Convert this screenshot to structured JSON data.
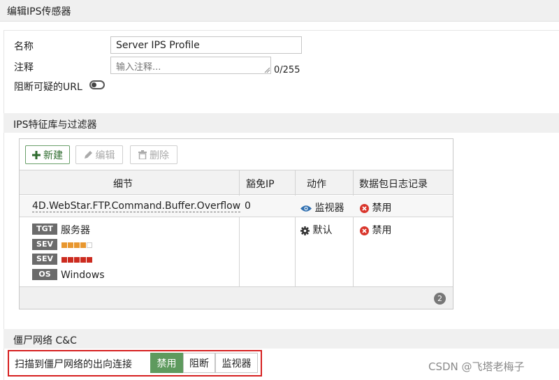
{
  "dialog": {
    "title": "编辑IPS传感器"
  },
  "form": {
    "name_label": "名称",
    "name_value": "Server IPS Profile",
    "comment_label": "注释",
    "comment_placeholder": "输入注释...",
    "comment_counter": "0/255",
    "block_url_label": "阻断可疑的URL",
    "block_url_enabled": false
  },
  "ips_section": {
    "title": "IPS特征库与过滤器",
    "toolbar": {
      "new_label": "新建",
      "edit_label": "编辑",
      "delete_label": "删除"
    },
    "columns": [
      "细节",
      "豁免IP",
      "动作",
      "数据包日志记录"
    ],
    "rows": [
      {
        "detail": "4D.WebStar.FTP.Command.Buffer.Overflow",
        "exempt_ip": "0",
        "action": "监视器",
        "action_icon": "eye-icon",
        "log": "禁用",
        "log_icon": "disabled-x-icon"
      },
      {
        "filters": [
          {
            "tag": "TGT",
            "value": "服务器"
          },
          {
            "tag": "SEV",
            "level": 4,
            "color": "#e8972f"
          },
          {
            "tag": "SEV",
            "level": 5,
            "color": "#cc2b1f"
          },
          {
            "tag": "OS",
            "value": "Windows"
          }
        ],
        "action": "默认",
        "action_icon": "gear-icon",
        "log": "禁用",
        "log_icon": "disabled-x-icon"
      }
    ],
    "page_count": "2"
  },
  "botnet_section": {
    "title": "僵尸网络 C&C",
    "scan_label": "扫描到僵尸网络的出向连接",
    "options": [
      "禁用",
      "阻断",
      "监视器"
    ],
    "selected": "禁用"
  },
  "watermark": "CSDN @飞塔老梅子",
  "colors": {
    "accent_green": "#5e9a5e",
    "highlight_red": "#d62020",
    "disabled_red": "#d9352b",
    "eye_blue": "#2f6fb0"
  }
}
